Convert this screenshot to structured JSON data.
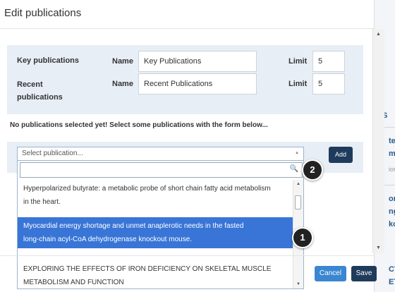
{
  "modal": {
    "title": "Edit publications"
  },
  "rows": [
    {
      "label_line1": "Key publications",
      "label_line2": "",
      "name_label": "Name",
      "name_value": "Key Publications",
      "limit_label": "Limit",
      "limit_value": "5"
    },
    {
      "label_line1": "Recent",
      "label_line2": "publications",
      "name_label": "Name",
      "name_value": "Recent Publications",
      "limit_label": "Limit",
      "limit_value": "5"
    }
  ],
  "notice": "No publications selected yet! Select some publications with the form below...",
  "select": {
    "placeholder": "Select publication...",
    "add_label": "Add",
    "search_value": "",
    "options": [
      {
        "line1": "Hyperpolarized butyrate: a metabolic probe of short chain fatty acid metabolism",
        "line2": "in the heart.",
        "selected": false
      },
      {
        "line1": "Myocardial energy shortage and unmet anaplerotic needs in the fasted",
        "line2": "long-chain acyl-CoA dehydrogenase knockout mouse.",
        "selected": true
      },
      {
        "line1": "EXPLORING THE EFFECTS OF IRON DEFICIENCY ON SKELETAL MUSCLE",
        "line2": "METABOLISM AND FUNCTION",
        "selected": false
      }
    ]
  },
  "badges": {
    "one": "1",
    "two": "2"
  },
  "footer": {
    "cancel_label": "Cancel",
    "save_label": "Save"
  },
  "background": {
    "fragments": [
      "IS",
      "te",
      "me",
      "ion",
      "or",
      "ng",
      "ko",
      "CT",
      "ET"
    ]
  },
  "colors": {
    "primary_dark": "#1f3b5c",
    "cancel_blue": "#3a86d1",
    "selected_option": "#3875d7",
    "panel_bg": "#e8eef6"
  }
}
